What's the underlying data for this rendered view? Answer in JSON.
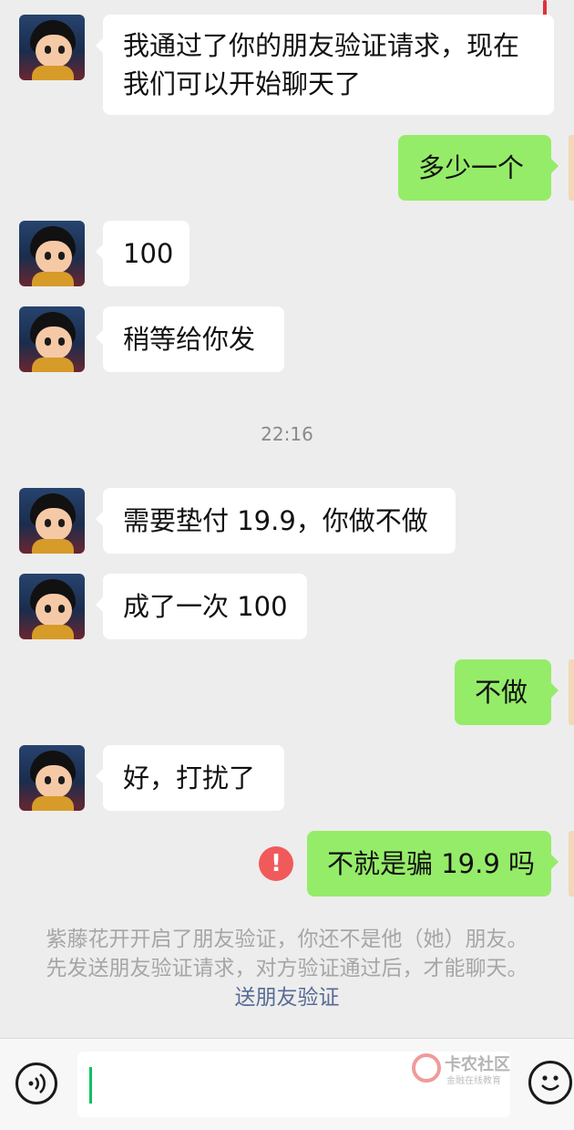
{
  "colors": {
    "background": "#ededed",
    "incoming_bubble": "#ffffff",
    "outgoing_bubble": "#95ec69",
    "error_icon": "#f05a5a",
    "link": "#576b95",
    "caret": "#07c160"
  },
  "messages": [
    {
      "direction": "in",
      "lines": [
        "我通过了你的朋友验证请求，现在",
        "我们可以开始聊天了"
      ]
    },
    {
      "direction": "out",
      "text": "多少一个"
    },
    {
      "direction": "in",
      "text": "100"
    },
    {
      "direction": "in",
      "text": "稍等给你发"
    },
    {
      "direction": "in",
      "text": "需要垫付 19.9，你做不做"
    },
    {
      "direction": "in",
      "text": "成了一次 100"
    },
    {
      "direction": "out",
      "text": "不做"
    },
    {
      "direction": "in",
      "text": "好，打扰了"
    },
    {
      "direction": "out",
      "text": "不就是骗 19.9 吗",
      "failed": true
    }
  ],
  "timestamp": "22:16",
  "error_icon_symbol": "!",
  "system_notice": {
    "line1": "紫藤花开开启了朋友验证，你还不是他（她）朋友。",
    "line2": "先发送朋友验证请求，对方验证通过后，才能聊天。",
    "link": "送朋友验证"
  },
  "input_bar": {
    "voice_icon": "voice-icon",
    "emoji_icon": "emoji-icon",
    "input_value": ""
  },
  "watermark": {
    "title": "卡农社区",
    "subtitle": "金融在线教育"
  }
}
